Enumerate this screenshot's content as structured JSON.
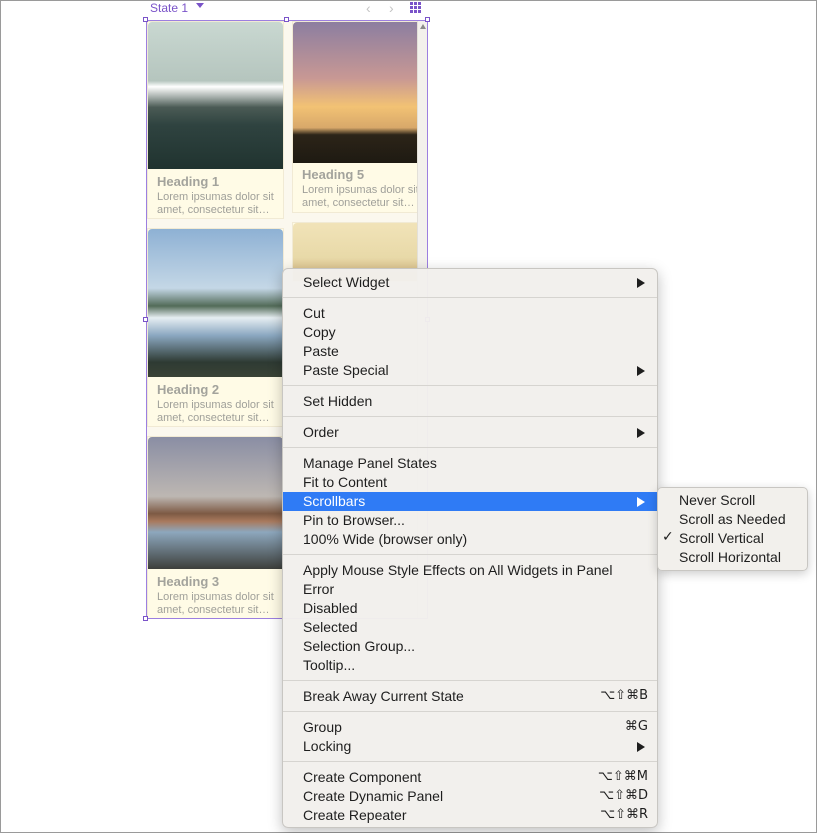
{
  "panel_header": {
    "state_label": "State 1",
    "prev_glyph": "‹",
    "next_glyph": "›",
    "state_menu_icon": "chevron-down-icon",
    "grid_icon": "grid-icon"
  },
  "cards": [
    {
      "heading": "Heading 1",
      "desc": "Lorem ipsumas dolor sit amet, consectetur sit…",
      "image": "mountain-lake"
    },
    {
      "heading": "Heading 5",
      "desc": "Lorem ipsumas dolor sit amet, consectetur sit…",
      "image": "palm-sunset"
    },
    {
      "heading": "Heading 2",
      "desc": "Lorem ipsumas dolor sit amet, consectetur sit…",
      "image": "lake-reflection"
    },
    {
      "heading": "",
      "desc": "",
      "image": "beach"
    },
    {
      "heading": "Heading 3",
      "desc": "Lorem ipsumas dolor sit amet, consectetur sit…",
      "image": "desert-reflection"
    }
  ],
  "context_menu": {
    "select_widget": "Select Widget",
    "cut": "Cut",
    "copy": "Copy",
    "paste": "Paste",
    "paste_special": "Paste Special",
    "set_hidden": "Set Hidden",
    "order": "Order",
    "manage_panel_states": "Manage Panel States",
    "fit_to_content": "Fit to Content",
    "scrollbars": "Scrollbars",
    "pin_to_browser": "Pin to Browser...",
    "wide": "100% Wide (browser only)",
    "apply_mouse_style": "Apply Mouse Style Effects on All Widgets in Panel",
    "error": "Error",
    "disabled": "Disabled",
    "selected": "Selected",
    "selection_group": "Selection Group...",
    "tooltip": "Tooltip...",
    "break_away": "Break Away Current State",
    "break_away_shortcut": "⌥⇧⌘B",
    "group": "Group",
    "group_shortcut": "⌘G",
    "locking": "Locking",
    "create_component": "Create Component",
    "create_component_shortcut": "⌥⇧⌘M",
    "create_dynamic_panel": "Create Dynamic Panel",
    "create_dynamic_panel_shortcut": "⌥⇧⌘D",
    "create_repeater": "Create Repeater",
    "create_repeater_shortcut": "⌥⇧⌘R",
    "active_item": "Scrollbars"
  },
  "scrollbars_submenu": {
    "items": [
      "Never Scroll",
      "Scroll as Needed",
      "Scroll Vertical",
      "Scroll Horizontal"
    ],
    "checked": "Scroll Vertical",
    "check_glyph": "✓"
  },
  "colors": {
    "accent_purple": "#7a53c9",
    "menu_highlight": "#2f7bf5"
  }
}
